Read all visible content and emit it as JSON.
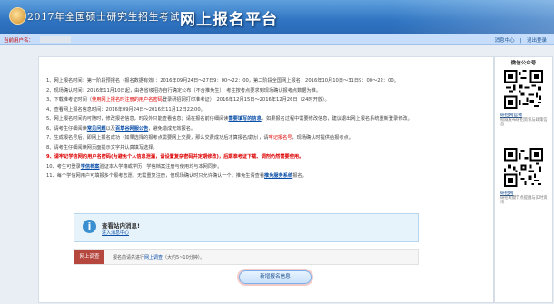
{
  "header": {
    "exam_title": "2017年全国硕士研究生招生考试",
    "platform_title": "网上报名平台"
  },
  "userbar": {
    "label": "当前用户名：",
    "links": [
      "消息中心",
      "|",
      "退出登录"
    ]
  },
  "notes": [
    {
      "pre": "1、网上报名时间：第一阶段预报名（报名数据有效）：2016年09月24日～27日9：00～22：00，第二阶段全国网上报名：2016年10月10日～31日9：00～22：00。"
    },
    {
      "pre": "2、现场确认时间：2016年11月10日起，由各省级招办自行确定公布（不含推免生），考生按考点要求到现场确认报考点数据为准。"
    },
    {
      "pre": "3、下载准考证时间（",
      "red": "使用网上报名时注册的用户名密码",
      "post": "登录研招网打印准考证）：2016年12月15日～2016年12月26日（24时开放）。"
    },
    {
      "pre": "4、查看网上报名信息时间：2016年09月24日～2016年11月12日22:00。"
    },
    {
      "pre": "5、网上报名时间内可随时，修改报名信息，时段外只能查看信息；请在报名前仔细阅读",
      "link": "需要填写的信息",
      "post": "，如果报名过程中需要修改信息，建议退出网上报名系统重新登录修改。"
    },
    {
      "pre": "6、请考生仔细阅读",
      "link": "常见问题",
      "mid": "以及",
      "link2": "百草谷网服公告",
      "post": "，避免造成无效报名。"
    },
    {
      "pre": "7、生成报名号后，即网上报名成功（如果选择的报考点需要网上交费，那么交费成功后才算报名成功），请",
      "red": "牢记报名号",
      "post": "，现场确认时提供给报考点。"
    },
    {
      "pre": "8、请考生仔细阅读网页面提示文字并认真填写选择。"
    },
    {
      "pre": "9、请牢记学信网的用户名密码(为避免个人信息泄漏，请设置复杂密码并定期修改)，后期准考证下载、调剂仍然需要使用。",
      "all_red": true
    },
    {
      "pre": "10、考生可登录",
      "link": "学信档案",
      "post": "验证本人学籍或学历，学信档案注册与使用均与本网同步。"
    },
    {
      "pre": "11、每个学信网用户可填报多个报考志愿，无需重复注册，但现场确认时只允许确认一个。推免生请查看",
      "link": "推免服务系统",
      "post": "报名。"
    }
  ],
  "message": {
    "title": "查看站内消息!",
    "link": "进入消息中心"
  },
  "survey": {
    "tag": "网上调查",
    "pre": "报名前请先进行",
    "link": "网上调查",
    "post": "（大约5~10分钟）。"
  },
  "add_button": "新增报名信息",
  "wechat": {
    "title": "微信公众号",
    "items": [
      {
        "name": "研招网官微",
        "desc": "权威发布研招资讯与政策信息"
      },
      {
        "name": "研招网",
        "desc": "研招关键节点提醒与实时资讯"
      }
    ]
  }
}
